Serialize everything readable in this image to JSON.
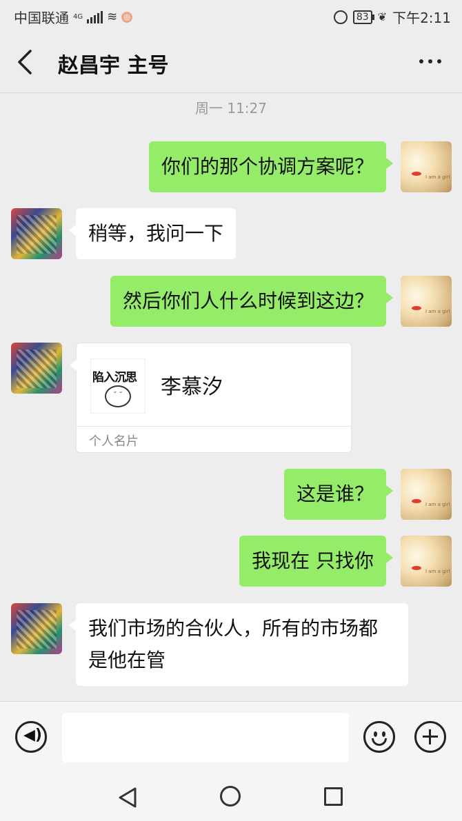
{
  "status_bar": {
    "carrier": "中国联通",
    "network": "4G",
    "battery": "83",
    "time": "下午2:11"
  },
  "header": {
    "title": "赵昌宇 主号"
  },
  "chat": {
    "timestamp": "周一 11:27",
    "messages": [
      {
        "from": "me",
        "text": "你们的那个协调方案呢？"
      },
      {
        "from": "other",
        "text": "稍等，我问一下"
      },
      {
        "from": "me",
        "text": "然后你们人什么时候到这边？"
      },
      {
        "from": "other",
        "type": "contact_card",
        "avatar_text": "陷入沉思",
        "name": "李慕汐",
        "label": "个人名片"
      },
      {
        "from": "me",
        "text": "这是谁？"
      },
      {
        "from": "me",
        "text": "我现在 只找你"
      },
      {
        "from": "other",
        "text": "我们市场的合伙人，所有的市场都是他在管"
      }
    ]
  },
  "input_bar": {
    "voice_icon": "voice-icon",
    "emoji_icon": "emoji-icon",
    "plus_icon": "plus-icon"
  },
  "colors": {
    "my_bubble": "#95ec69",
    "other_bubble": "#ffffff",
    "background": "#ededed"
  }
}
